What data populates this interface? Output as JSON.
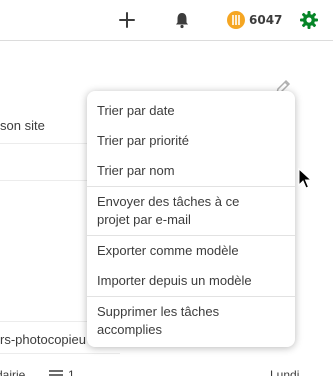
{
  "topbar": {
    "add_icon": "plus-icon",
    "notifications_icon": "bell-icon",
    "karma_icon": "karma-coin-icon",
    "karma_count": "6047",
    "settings_icon": "gear-icon",
    "accent_color": "#058527",
    "coin_color": "#f5a623"
  },
  "background": {
    "task_row_1_text": "son site",
    "task_row_2_text": "rs-photocopieu",
    "bottom_left_text": "dairie",
    "bottom_count": "1",
    "bottom_right_text": "Lundi"
  },
  "menu": {
    "items": [
      {
        "label": "Trier par date"
      },
      {
        "label": "Trier par priorité"
      },
      {
        "label": "Trier par nom"
      },
      {
        "label_line1": "Envoyer des tâches à ce",
        "label_line2": "projet par e-mail"
      },
      {
        "label": "Exporter comme modèle"
      },
      {
        "label": "Importer depuis un modèle"
      },
      {
        "label_line1": "Supprimer les tâches",
        "label_line2": "accomplies"
      }
    ]
  }
}
